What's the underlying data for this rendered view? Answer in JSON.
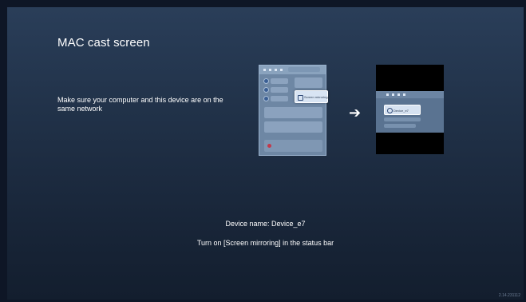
{
  "page": {
    "title": "MAC cast screen",
    "instruction": "Make sure your computer and this device are on the same network",
    "device_label": "Device name:",
    "device_name": "Device_e7",
    "hint": "Turn on [Screen mirroring] in the status bar",
    "version": "2.14.231112"
  },
  "illustration_left": {
    "tile_label": "Screen mirroring"
  },
  "illustration_right": {
    "device_tile_label": "Device_e7"
  },
  "icons": {
    "arrow": "arrow-right-icon",
    "arrow_glyph": "➔"
  },
  "colors": {
    "background_top": "#2a3e59",
    "background_bottom": "#131e2e",
    "text": "#ffffff"
  }
}
